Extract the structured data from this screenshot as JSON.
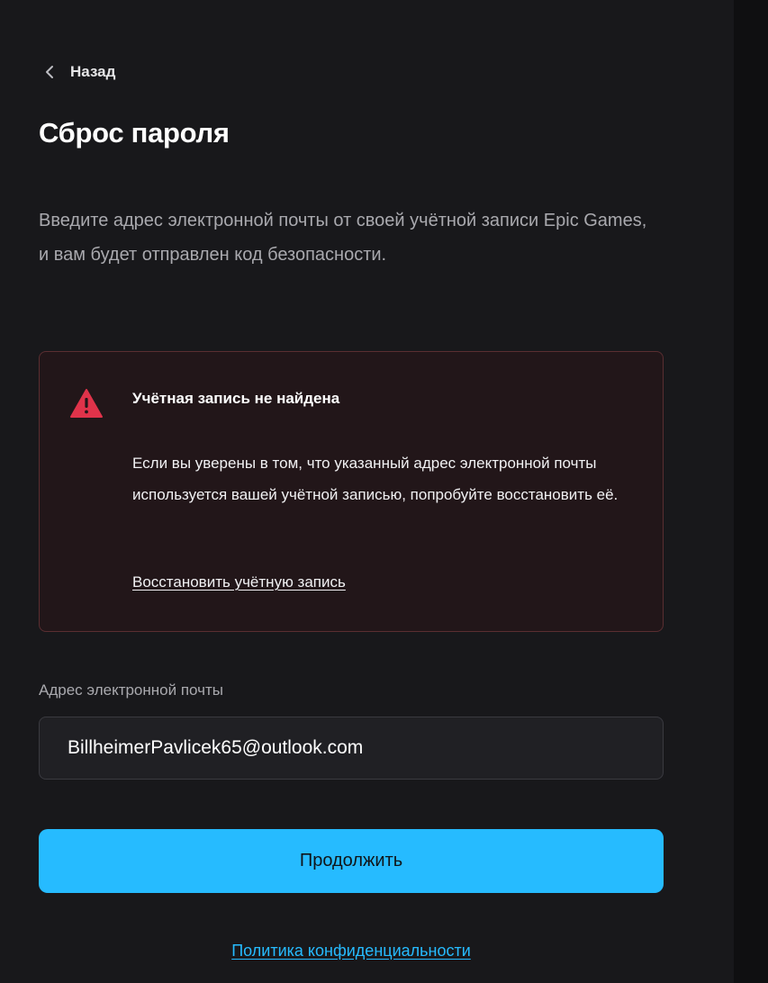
{
  "header": {
    "back_label": "Назад",
    "back_icon": "chevron-left-icon"
  },
  "page": {
    "title": "Сброс пароля",
    "intro": "Введите адрес электронной почты от своей учётной записи Epic Games, и вам будет отправлен код безопасности."
  },
  "alert": {
    "icon": "warning-triangle-icon",
    "icon_color": "#e0334a",
    "title": "Учётная запись не найдена",
    "body": "Если вы уверены в том, что указанный адрес электронной почты используется вашей учётной записью, попробуйте восстановить её.",
    "link_label": "Восстановить учётную запись"
  },
  "form": {
    "email_label": "Адрес электронной почты",
    "email_value": "BillheimerPavlicek65@outlook.com",
    "continue_label": "Продолжить"
  },
  "footer": {
    "privacy_label": "Политика конфиденциальности"
  },
  "colors": {
    "accent": "#26bbff",
    "background": "#18181b",
    "alert_background": "#221619",
    "alert_border": "#5a2e31"
  }
}
